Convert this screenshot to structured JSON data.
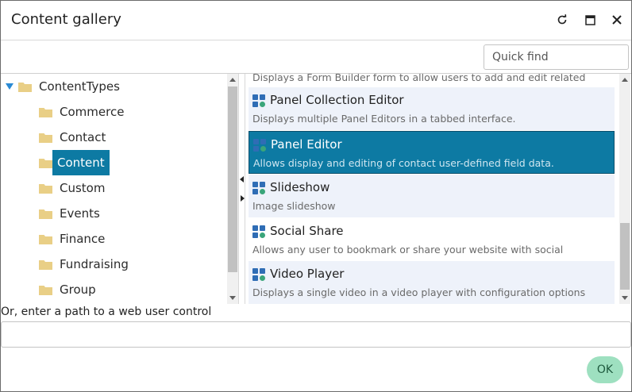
{
  "dialog": {
    "title": "Content gallery",
    "controls": {
      "refresh_icon": "refresh-icon",
      "maximize_icon": "maximize-icon",
      "close_icon": "close-icon"
    }
  },
  "search": {
    "placeholder": "Quick find",
    "value": ""
  },
  "tree": {
    "root": {
      "label": "ContentTypes",
      "expanded": true
    },
    "items": [
      {
        "label": "Commerce"
      },
      {
        "label": "Contact"
      },
      {
        "label": "Content",
        "selected": true
      },
      {
        "label": "Custom"
      },
      {
        "label": "Events"
      },
      {
        "label": "Finance"
      },
      {
        "label": "Fundraising"
      },
      {
        "label": "Group"
      }
    ],
    "scroll_position": 0.0
  },
  "list": {
    "partial_top_desc": "Displays a Form Builder form to allow users to add and edit related",
    "items": [
      {
        "name": "Panel Collection Editor",
        "desc": "Displays multiple Panel Editors in a tabbed interface."
      },
      {
        "name": "Panel Editor",
        "desc": "Allows display and editing of contact user-defined field data.",
        "selected": true
      },
      {
        "name": "Slideshow",
        "desc": "Image slideshow"
      },
      {
        "name": "Social Share",
        "desc": "Allows any user to bookmark or share your website with social"
      },
      {
        "name": "Video Player",
        "desc": "Displays a single video in a video player with configuration options"
      }
    ],
    "scroll_position": 1.0
  },
  "path": {
    "label": "Or, enter a path to a web user control",
    "value": ""
  },
  "footer": {
    "ok_label": "OK"
  },
  "colors": {
    "selection": "#0d7aa3",
    "folder": "#e9cf86",
    "ok_button": "#9ee0c0",
    "icon_blue": "#2f6db5",
    "icon_green": "#3aa57a"
  }
}
